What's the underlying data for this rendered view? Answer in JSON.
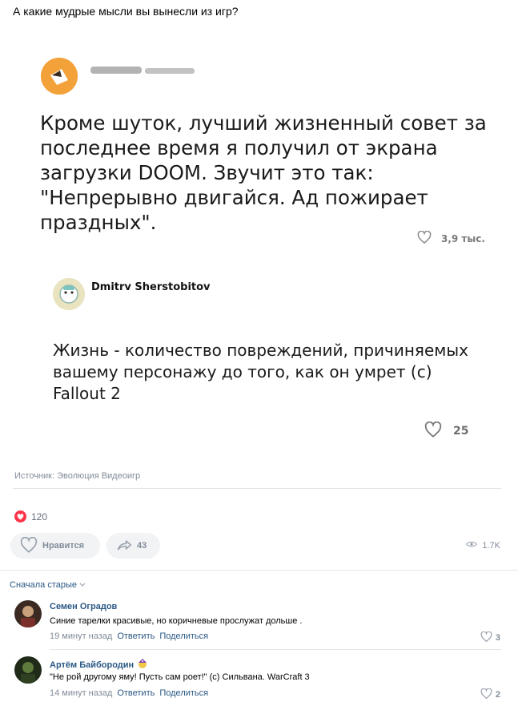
{
  "post": {
    "title": "А какие мудрые мысли вы вынесли из игр?",
    "screenshot1": {
      "text": "Кроме шуток, лучший жизненный совет за последнее время я получил от экрана загрузки DOOM. Звучит это так: \"Непрерывно двигайся. Ад пожирает праздных\".",
      "likes": "3,9 тыс."
    },
    "screenshot2": {
      "author": "Dmitry Sherstobitov",
      "text": "Жизнь - количество повреждений, причиняемых вашему персонажу до того, как он умрет (с) Fallout 2",
      "likes": "25"
    },
    "source": "Источник: Эволюция Видеоигр",
    "reactions_count": "120",
    "like_label": "Нравится",
    "shares_count": "43",
    "views": "1.7K"
  },
  "comments_sort": "Сначала старые",
  "comments": [
    {
      "author": "Семен Оградов",
      "text": "Синие тарелки красивые, но коричневые прослужат дольше .",
      "time": "19 минут назад",
      "reply": "Ответить",
      "share": "Поделиться",
      "likes": "3"
    },
    {
      "author": "Артём Байбородин",
      "text": "\"Не рой другому яму! Пусть сам роет!\" (с) Сильвана. WarCraft 3",
      "time": "14 минут назад",
      "reply": "Ответить",
      "share": "Поделиться",
      "likes": "2"
    }
  ],
  "colors": {
    "link": "#2a5885",
    "muted": "#818c99",
    "heart": "#ff3347"
  }
}
